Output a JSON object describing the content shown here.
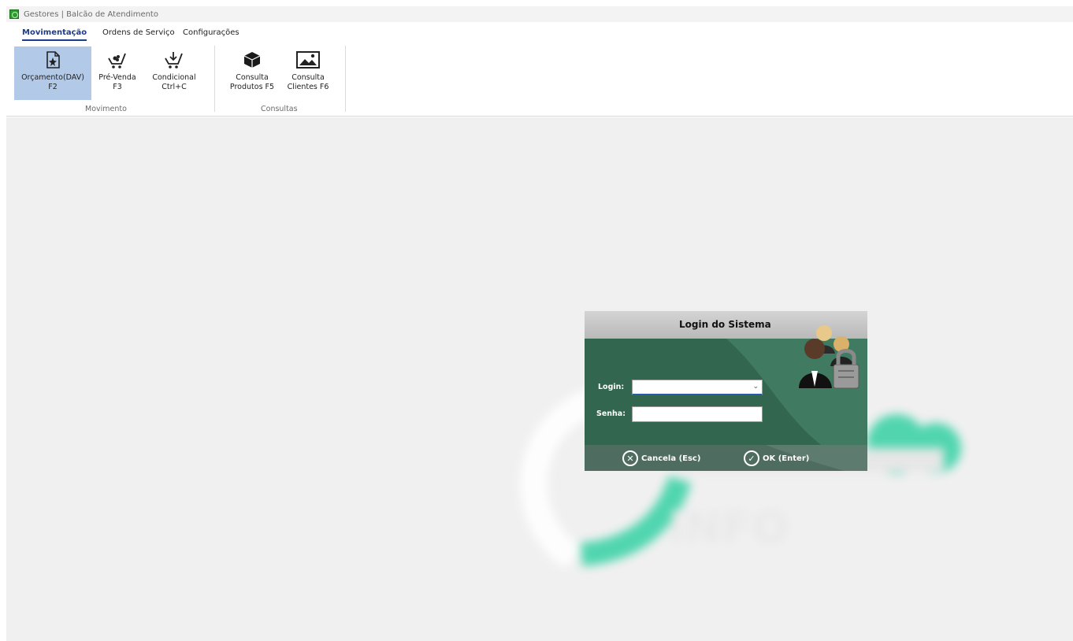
{
  "window": {
    "title": "Gestores | Balcão de Atendimento"
  },
  "menu": {
    "tabs": [
      {
        "label": "Movimentação"
      },
      {
        "label": "Ordens de Serviço"
      },
      {
        "label": "Configurações"
      }
    ]
  },
  "ribbon": {
    "groups": [
      {
        "label": "Movimento"
      },
      {
        "label": "Consultas"
      }
    ],
    "buttons": [
      {
        "label": "Orçamento(DAV)\nF2",
        "icon": "document-star-icon"
      },
      {
        "label": "Pré-Venda\nF3",
        "icon": "cart-icon"
      },
      {
        "label": "Condicional\nCtrl+C",
        "icon": "cart-arrow-icon"
      },
      {
        "label": "Consulta\nProdutos F5",
        "icon": "box-icon"
      },
      {
        "label": "Consulta\nClientes F6",
        "icon": "image-icon"
      }
    ]
  },
  "login": {
    "title": "Login do Sistema",
    "login_label": "Login:",
    "password_label": "Senha:",
    "login_value": "",
    "password_value": "",
    "cancel_label": "Cancela (Esc)",
    "ok_label": "OK (Enter)"
  },
  "watermark": {
    "text": "INFO"
  },
  "colors": {
    "accent": "#1c3d8c",
    "dialog_green": "#33664f",
    "selected_bg": "#b2c9e8"
  }
}
